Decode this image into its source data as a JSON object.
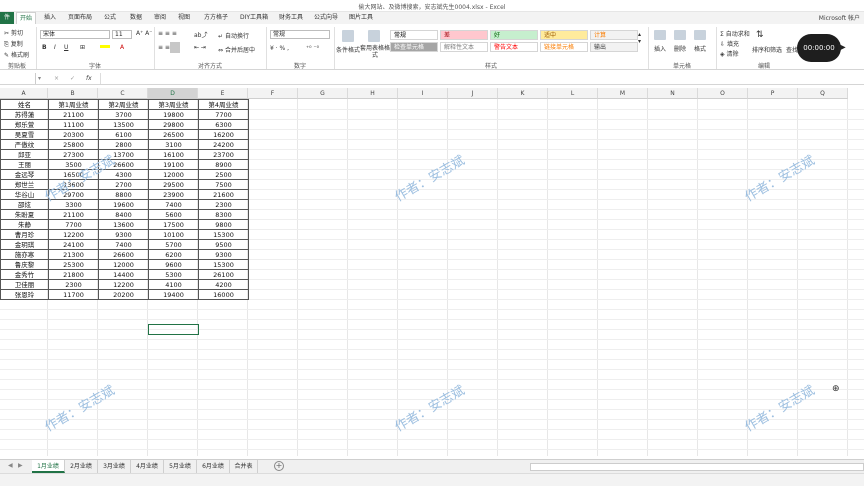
{
  "window": {
    "title": "偷大网站、及微博搜索，安志斌先生0004.xlsx - Excel",
    "account": "Microsoft 帐户"
  },
  "menu": {
    "file": "件",
    "tabs": [
      "开始",
      "插入",
      "页面布局",
      "公式",
      "数据",
      "审阅",
      "视图",
      "方方格子",
      "DIY工具箱",
      "财务工具",
      "公式向导",
      "图片工具"
    ],
    "active": "开始"
  },
  "ribbon": {
    "clipboard": {
      "cut": "剪切",
      "copy": "复制",
      "paste_format": "格式刷",
      "label": "剪贴板"
    },
    "font": {
      "name": "宋体",
      "size": "11",
      "label": "字体",
      "bold": "B",
      "italic": "I",
      "underline": "U"
    },
    "alignment": {
      "wrap": "自动换行",
      "merge": "合并后居中",
      "label": "对齐方式"
    },
    "number": {
      "format": "常规",
      "label": "数字"
    },
    "styles": {
      "cond": "条件格式",
      "table": "套用表格格式",
      "label": "样式",
      "items": [
        {
          "text": "常规",
          "bg": "#ffffff",
          "fg": "#000000"
        },
        {
          "text": "差",
          "bg": "#ffc7ce",
          "fg": "#9c0006"
        },
        {
          "text": "好",
          "bg": "#c6efce",
          "fg": "#006100"
        },
        {
          "text": "适中",
          "bg": "#ffeb9c",
          "fg": "#9c5700"
        },
        {
          "text": "计算",
          "bg": "#f2f2f2",
          "fg": "#fa7d00"
        },
        {
          "text": "检查单元格",
          "bg": "#a5a5a5",
          "fg": "#ffffff"
        },
        {
          "text": "解释性文本",
          "bg": "#ffffff",
          "fg": "#7f7f7f"
        },
        {
          "text": "警告文本",
          "bg": "#ffffff",
          "fg": "#ff0000"
        },
        {
          "text": "链接单元格",
          "bg": "#ffffff",
          "fg": "#fa7d00"
        },
        {
          "text": "输出",
          "bg": "#f2f2f2",
          "fg": "#3f3f3f"
        }
      ]
    },
    "cells": {
      "insert": "插入",
      "delete": "删除",
      "format": "格式",
      "label": "单元格"
    },
    "editing": {
      "autosum": "自动求和",
      "fill": "填充",
      "clear": "清除",
      "sort": "排序和筛选",
      "find": "查找和",
      "label": "编辑"
    }
  },
  "recorder": {
    "time": "00:00:00"
  },
  "formula_bar": {
    "fx": "fx",
    "cancel": "×",
    "enter": "✓",
    "namebox": ""
  },
  "columns": [
    "A",
    "B",
    "C",
    "D",
    "E",
    "F",
    "G",
    "H",
    "I",
    "J",
    "K",
    "L",
    "M",
    "N",
    "O",
    "P",
    "Q"
  ],
  "selected_column": "D",
  "table": {
    "headers": [
      "姓名",
      "第1周业绩",
      "第2周业绩",
      "第3周业绩",
      "第4周业绩"
    ],
    "rows": [
      [
        "苏得蓮",
        "21100",
        "3700",
        "19800",
        "7700"
      ],
      [
        "郑乐萱",
        "11100",
        "13500",
        "29800",
        "6300"
      ],
      [
        "吴夏雪",
        "20300",
        "6100",
        "26500",
        "16200"
      ],
      [
        "严傲纹",
        "25800",
        "2800",
        "3100",
        "24200"
      ],
      [
        "邱亚",
        "27300",
        "13700",
        "16100",
        "23700"
      ],
      [
        "王丽",
        "3500",
        "26600",
        "19100",
        "8900"
      ],
      [
        "金远琴",
        "16500",
        "4300",
        "12000",
        "2500"
      ],
      [
        "郑世兰",
        "13600",
        "2700",
        "29500",
        "7500"
      ],
      [
        "华谷山",
        "29700",
        "8800",
        "23900",
        "21600"
      ],
      [
        "邵炫",
        "3300",
        "19600",
        "7400",
        "2300"
      ],
      [
        "朱盼夏",
        "21100",
        "8400",
        "5600",
        "8300"
      ],
      [
        "朱静",
        "7700",
        "13600",
        "17500",
        "9800"
      ],
      [
        "曹月珍",
        "12200",
        "9300",
        "10100",
        "15300"
      ],
      [
        "金玥琪",
        "24100",
        "7400",
        "5700",
        "9500"
      ],
      [
        "施亦寒",
        "21300",
        "26600",
        "6200",
        "9300"
      ],
      [
        "鲁庆黎",
        "25300",
        "12000",
        "9600",
        "15300"
      ],
      [
        "金秀竹",
        "21800",
        "14400",
        "5300",
        "26100"
      ],
      [
        "卫佳丽",
        "2300",
        "12200",
        "4100",
        "4200"
      ],
      [
        "张恩玲",
        "11700",
        "20200",
        "19400",
        "16000"
      ]
    ]
  },
  "watermark": "作者：安志斌",
  "sheets": [
    "1月业绩",
    "2月业绩",
    "3月业绩",
    "4月业绩",
    "5月业绩",
    "6月业绩",
    "合并表"
  ],
  "active_sheet": "1月业绩"
}
